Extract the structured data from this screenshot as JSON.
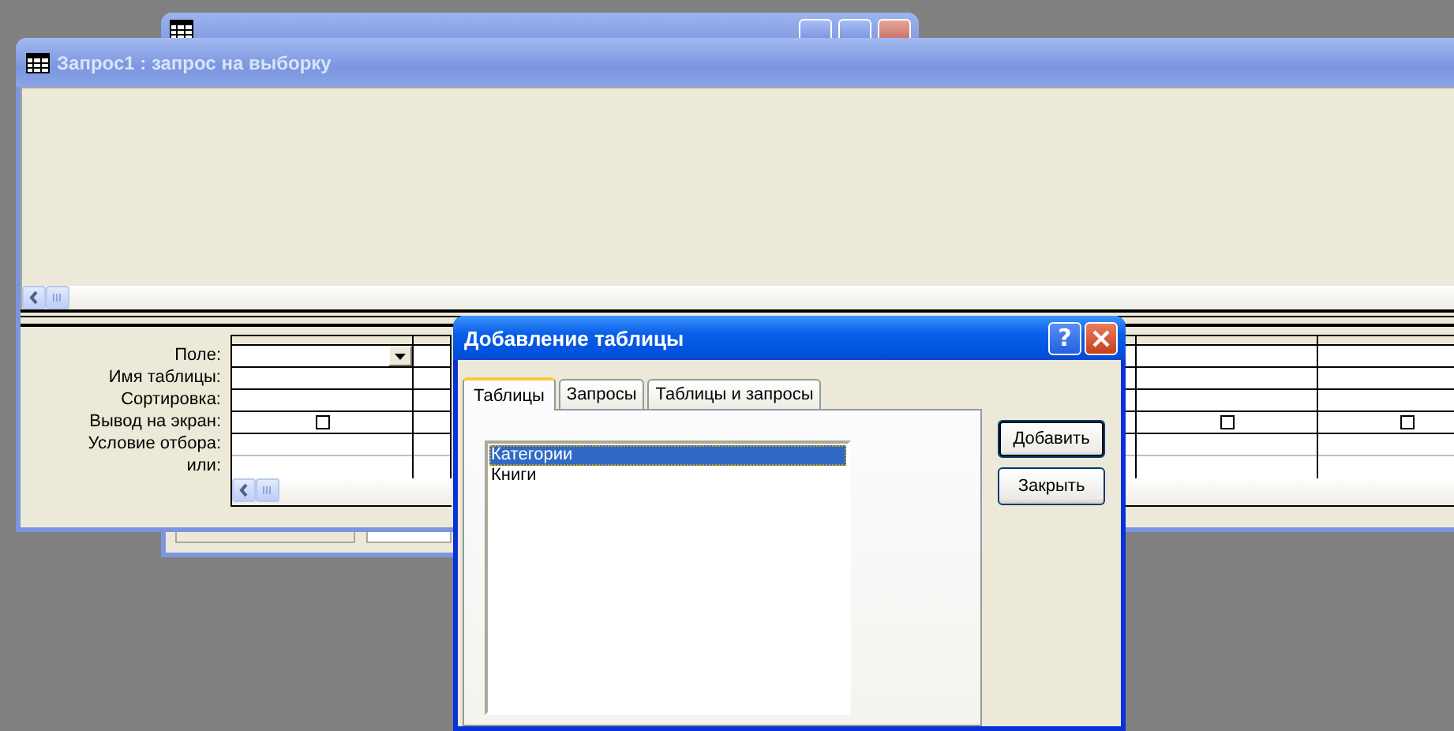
{
  "query_window": {
    "title": "Запрос1 : запрос на выборку"
  },
  "design_grid": {
    "row_labels": [
      "Поле:",
      "Имя таблицы:",
      "Сортировка:",
      "Вывод на экран:",
      "Условие отбора:",
      "или:"
    ],
    "columns": [
      {
        "kind": "field",
        "active": true,
        "show": false
      },
      {
        "kind": "covered"
      },
      {
        "kind": "covered"
      },
      {
        "kind": "covered"
      },
      {
        "kind": "covered"
      },
      {
        "kind": "field",
        "show": false
      },
      {
        "kind": "field",
        "show": false
      }
    ]
  },
  "dialog": {
    "title": "Добавление таблицы",
    "help_glyph": "?",
    "tabs": [
      {
        "label": "Таблицы",
        "selected": true
      },
      {
        "label": "Запросы",
        "selected": false
      },
      {
        "label": "Таблицы и запросы",
        "selected": false
      }
    ],
    "list_items": [
      {
        "label": "Категории",
        "selected": true
      },
      {
        "label": "Книги",
        "selected": false
      }
    ],
    "buttons": [
      "Добавить",
      "Закрыть"
    ]
  }
}
